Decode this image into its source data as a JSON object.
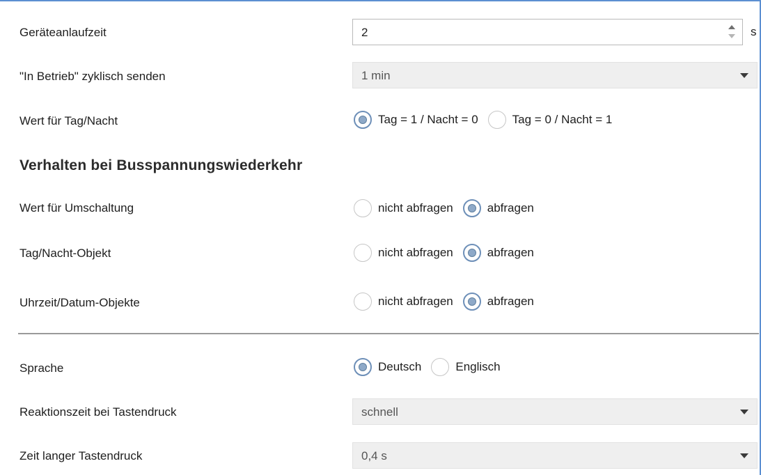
{
  "rows": {
    "startup": {
      "label": "Geräteanlaufzeit",
      "value": "2",
      "unit": "s"
    },
    "cyclic": {
      "label": "\"In Betrieb\" zyklisch senden",
      "value": "1 min"
    },
    "daynight_value": {
      "label": "Wert für Tag/Nacht",
      "options": [
        "Tag = 1 / Nacht = 0",
        "Tag = 0 / Nacht = 1"
      ],
      "selected": 0
    }
  },
  "section": {
    "title": "Verhalten bei Busspannungswiederkehr",
    "switching": {
      "label": "Wert für Umschaltung",
      "options": [
        "nicht abfragen",
        "abfragen"
      ],
      "selected": 1
    },
    "daynight_object": {
      "label": "Tag/Nacht-Objekt",
      "options": [
        "nicht abfragen",
        "abfragen"
      ],
      "selected": 1
    },
    "time_date": {
      "label": "Uhrzeit/Datum-Objekte",
      "options": [
        "nicht abfragen",
        "abfragen"
      ],
      "selected": 1
    }
  },
  "settings": {
    "language": {
      "label": "Sprache",
      "options": [
        "Deutsch",
        "Englisch"
      ],
      "selected": 0
    },
    "reaction": {
      "label": "Reaktionszeit bei Tastendruck",
      "value": "schnell"
    },
    "long_press": {
      "label": "Zeit langer Tastendruck",
      "value": "0,4 s"
    }
  },
  "colors": {
    "accent_border": "#5b8fd1",
    "radio_selected": "#8ea9c8",
    "select_bg": "#efefef"
  }
}
